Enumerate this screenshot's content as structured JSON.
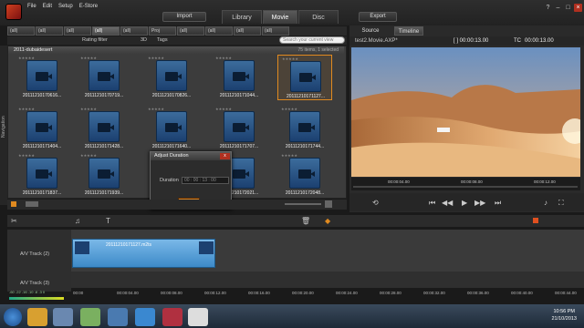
{
  "menu": [
    "File",
    "Edit",
    "Setup",
    "E-Store"
  ],
  "top_buttons": {
    "import": "Import",
    "export": "Export"
  },
  "main_tabs": [
    "Library",
    "Movie",
    "Disc"
  ],
  "active_main_tab": "Movie",
  "window_controls": {
    "help": "?",
    "minimize": "–",
    "maximize": "□",
    "close": "×"
  },
  "library_tabs": [
    "(all)",
    "(all)",
    "(all)",
    "(all)",
    "(all)",
    "Proj",
    "(all)",
    "(all)",
    "(all)",
    "(all)"
  ],
  "filter": {
    "label": "Rating filter",
    "mode": "3D",
    "tags": "Tags",
    "search_placeholder": "Search your current view"
  },
  "folder": {
    "name": "2011-dubaidesert",
    "count": "75 items, 1 selected"
  },
  "thumbnails": [
    [
      "20111210170616...",
      "20111210170719...",
      "20111210170826...",
      "20111210171044...",
      "20111210171127..."
    ],
    [
      "20111210171404...",
      "20111210171428...",
      "20111210171640...",
      "20111210171707...",
      "20111210171744..."
    ],
    [
      "20111210171837...",
      "20111210171939...",
      "",
      "20111210172021...",
      "20111210172048..."
    ]
  ],
  "nav_label": "Navigation",
  "dialog": {
    "title": "Adjust Duration",
    "label": "Duration",
    "value": "00 : 00 : 13 : 00",
    "highlight": "13",
    "ok": "OK",
    "close": "x"
  },
  "preview": {
    "tabs": [
      "Source",
      "Timeline"
    ],
    "active_tab": "Timeline",
    "file": "test2.Movie.AXP*",
    "timecode": "[ ] 00:00:13.00",
    "tc_label": "TC",
    "tc_value": "00:00:13.00",
    "ruler": [
      "00:00:04.00",
      "00:00:08.00",
      "00:00:12.00"
    ]
  },
  "timeline": {
    "tracks": [
      {
        "name": "A/V Track (2)"
      },
      {
        "name": "A/V Track (3)"
      }
    ],
    "clip_label": "20111210171127.m2ts",
    "ticks": [
      "00:00",
      "00:00:04.00",
      "00:00:08.00",
      "00:00:12.00",
      "00:00:16.00",
      "00:00:20.00",
      "00:00:24.00",
      "00:00:28.00",
      "00:00:32.00",
      "00:00:36.00",
      "00:00:40.00",
      "00:00:44.00"
    ],
    "meter_scale": "-60 -22 -16 -10 -6 -3 0"
  },
  "taskbar": {
    "time": "10:56 PM",
    "date": "21/10/2013"
  },
  "colors": {
    "accent": "#e08a20",
    "clip": "#5aa0d8",
    "close": "#b03020"
  }
}
